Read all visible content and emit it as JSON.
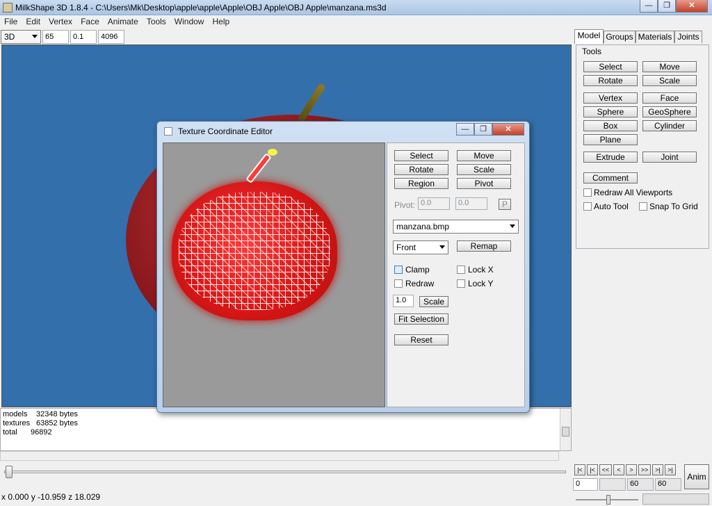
{
  "app": {
    "title": "MilkShape 3D 1.8.4 - C:\\Users\\Mk\\Desktop\\apple\\apple\\Apple\\OBJ Apple\\OBJ Apple\\manzana.ms3d",
    "window_controls": {
      "minimize": "—",
      "maximize": "❐",
      "close": "✕"
    }
  },
  "menu": [
    "File",
    "Edit",
    "Vertex",
    "Face",
    "Animate",
    "Tools",
    "Window",
    "Help"
  ],
  "toolbar": {
    "view_mode": "3D",
    "field1": "65",
    "field2": "0.1",
    "field3": "4096"
  },
  "log": {
    "lines": [
      {
        "label": "models",
        "value": "32348 bytes"
      },
      {
        "label": "textures",
        "value": "63852 bytes"
      },
      {
        "label": "total",
        "value": "96892"
      }
    ]
  },
  "status": {
    "coords": "x 0.000 y -10.959 z 18.029"
  },
  "right_panel": {
    "tabs": [
      "Model",
      "Groups",
      "Materials",
      "Joints"
    ],
    "tools_label": "Tools",
    "buttons": {
      "select": "Select",
      "move": "Move",
      "rotate": "Rotate",
      "scale": "Scale",
      "vertex": "Vertex",
      "face": "Face",
      "sphere": "Sphere",
      "geosphere": "GeoSphere",
      "box": "Box",
      "cylinder": "Cylinder",
      "plane": "Plane",
      "extrude": "Extrude",
      "joint": "Joint",
      "comment": "Comment"
    },
    "checks": {
      "redraw_all": "Redraw All Viewports",
      "auto_tool": "Auto Tool",
      "snap_grid": "Snap To Grid"
    },
    "anim": {
      "anim_button": "Anim",
      "nav": [
        "|<",
        "|<",
        "<<",
        "<",
        ">",
        ">>",
        ">|",
        ">|"
      ],
      "frame_start": "0",
      "frame_mid": "",
      "frame_a": "60",
      "frame_b": "60"
    }
  },
  "tce": {
    "title": "Texture Coordinate Editor",
    "controls": {
      "minimize": "—",
      "restore": "❐",
      "close": "✕"
    },
    "buttons": {
      "select": "Select",
      "move": "Move",
      "rotate": "Rotate",
      "scale": "Scale",
      "region": "Region",
      "pivot": "Pivot",
      "remap": "Remap",
      "scale2": "Scale",
      "fit": "Fit Selection",
      "reset": "Reset",
      "p": "P"
    },
    "pivot_label": "Pivot:",
    "pivot_x": "0.0",
    "pivot_y": "0.0",
    "texture": "manzana.bmp",
    "view": "Front",
    "checks": {
      "clamp": "Clamp",
      "lockx": "Lock X",
      "redraw": "Redraw",
      "locky": "Lock Y"
    },
    "scale_value": "1.0"
  }
}
